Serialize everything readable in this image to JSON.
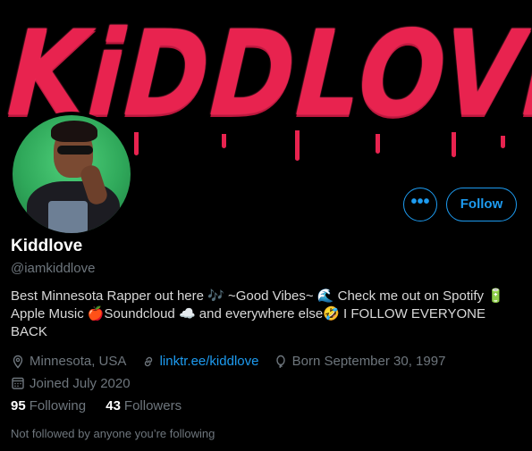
{
  "banner": {
    "text": "KiDDLOVE",
    "color": "#e8234f"
  },
  "profile": {
    "name": "Kiddlove",
    "handle": "@iamkiddlove",
    "bio": "Best Minnesota Rapper out here 🎶 ~Good Vibes~ 🌊 Check me out on Spotify 🔋 Apple Music 🍎Soundcloud ☁️ and everywhere else🤣 I FOLLOW EVERYONE BACK",
    "location": "Minnesota, USA",
    "link": "linktr.ee/kiddlove",
    "birthday": "Born September 30, 1997",
    "joined": "Joined July 2020"
  },
  "actions": {
    "more_label": "•••",
    "follow_label": "Follow"
  },
  "stats": {
    "following_count": "95",
    "following_label": "Following",
    "followers_count": "43",
    "followers_label": "Followers"
  },
  "note": "Not followed by anyone you’re following",
  "colors": {
    "accent": "#1d9bf0",
    "secondary_text": "#6e767d",
    "background": "#000000"
  }
}
